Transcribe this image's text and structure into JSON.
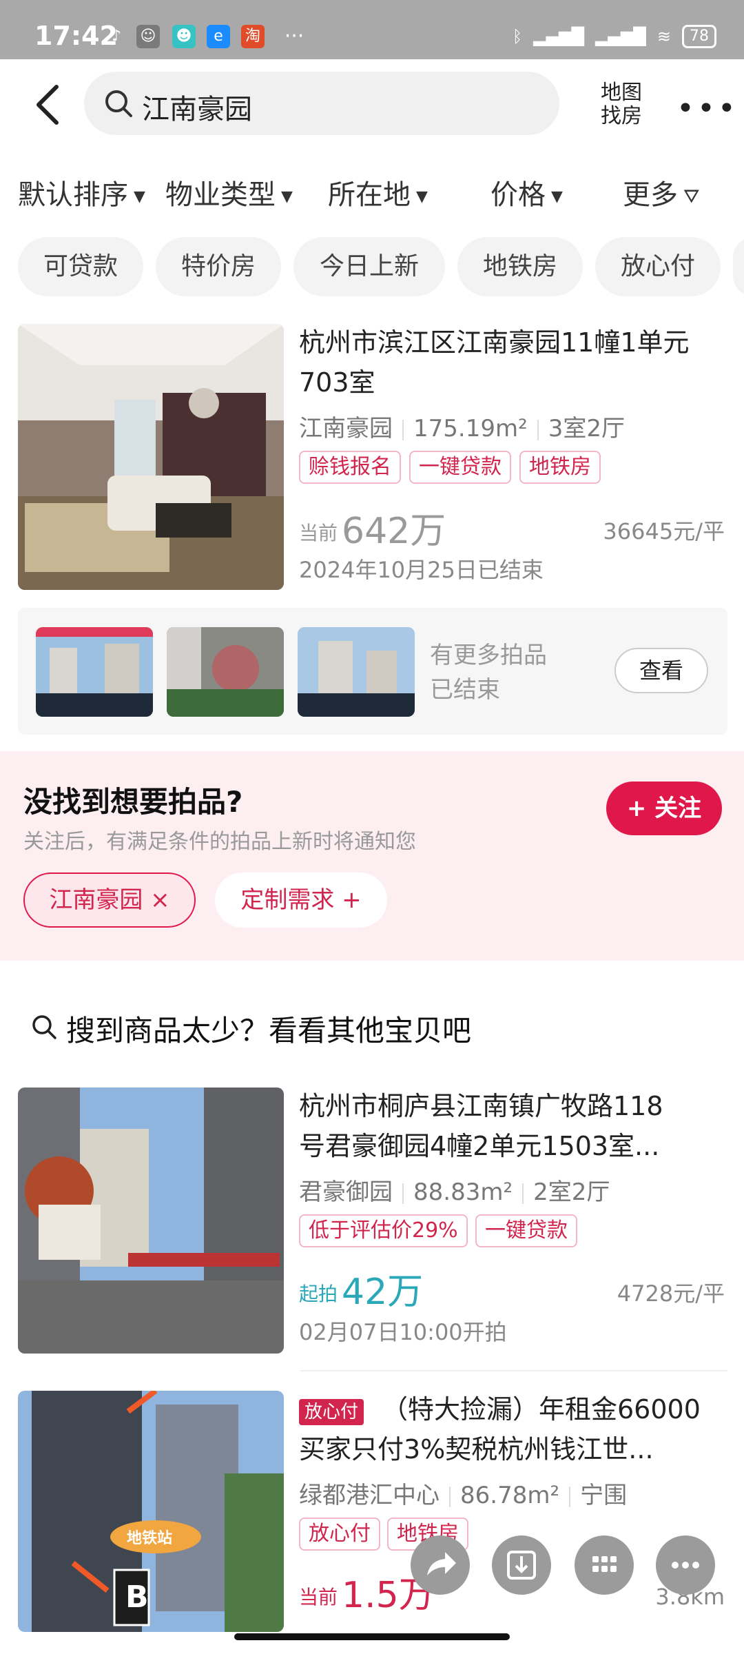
{
  "status_bar": {
    "time": "17:42",
    "battery": "78"
  },
  "header": {
    "search_value": "江南豪园",
    "map_line1": "地图",
    "map_line2": "找房"
  },
  "filters": [
    "默认排序",
    "物业类型",
    "所在地",
    "价格",
    "更多"
  ],
  "chips": [
    "可贷款",
    "特价房",
    "今日上新",
    "地铁房",
    "放心付"
  ],
  "listing1": {
    "title_line1": "杭州市滨江区江南豪园11幢1单元",
    "title_line2": "703室",
    "community": "江南豪园",
    "area": "175.19m²",
    "layout": "3室2厅",
    "tags": [
      "赊钱报名",
      "一键贷款",
      "地铁房"
    ],
    "price_label": "当前",
    "price": "642万",
    "unit_price": "36645元/平",
    "status": "2024年10月25日已结束"
  },
  "more_ended": {
    "line1": "有更多拍品",
    "line2": "已结束",
    "button": "查看"
  },
  "subscribe": {
    "title": "没找到想要拍品?",
    "desc": "关注后，有满足条件的拍品上新时将通知您",
    "follow": "+ 关注",
    "keyword": "江南豪园 ×",
    "custom": "定制需求 +"
  },
  "suggest_title": "搜到商品太少？看看其他宝贝吧",
  "listing2": {
    "title_line1": "杭州市桐庐县江南镇广牧路118",
    "title_line2": "号君豪御园4幢2单元1503室...",
    "community": "君豪御园",
    "area": "88.83m²",
    "layout": "2室2厅",
    "tags": [
      "低于评估价29%",
      "一键贷款"
    ],
    "price_label": "起拍",
    "price": "42万",
    "unit_price": "4728元/平",
    "status": "02月07日10:00开拍"
  },
  "listing3": {
    "badge": "放心付",
    "title_line1": "（特大捡漏）年租金66000",
    "title_line2": "买家只付3%契税杭州钱江世...",
    "community": "绿都港汇中心",
    "area": "86.78m²",
    "layout": "宁围",
    "tags": [
      "放心付",
      "地铁房"
    ],
    "price_label": "当前",
    "price": "1.5万",
    "distance": "3.8km",
    "image_label": "地铁站",
    "image_letter": "B"
  },
  "colors": {
    "accent": "#e0174a",
    "teal": "#2aa8b8",
    "chip_bg": "#f3f3f3",
    "subscribe_bg": "#fdeef1"
  }
}
